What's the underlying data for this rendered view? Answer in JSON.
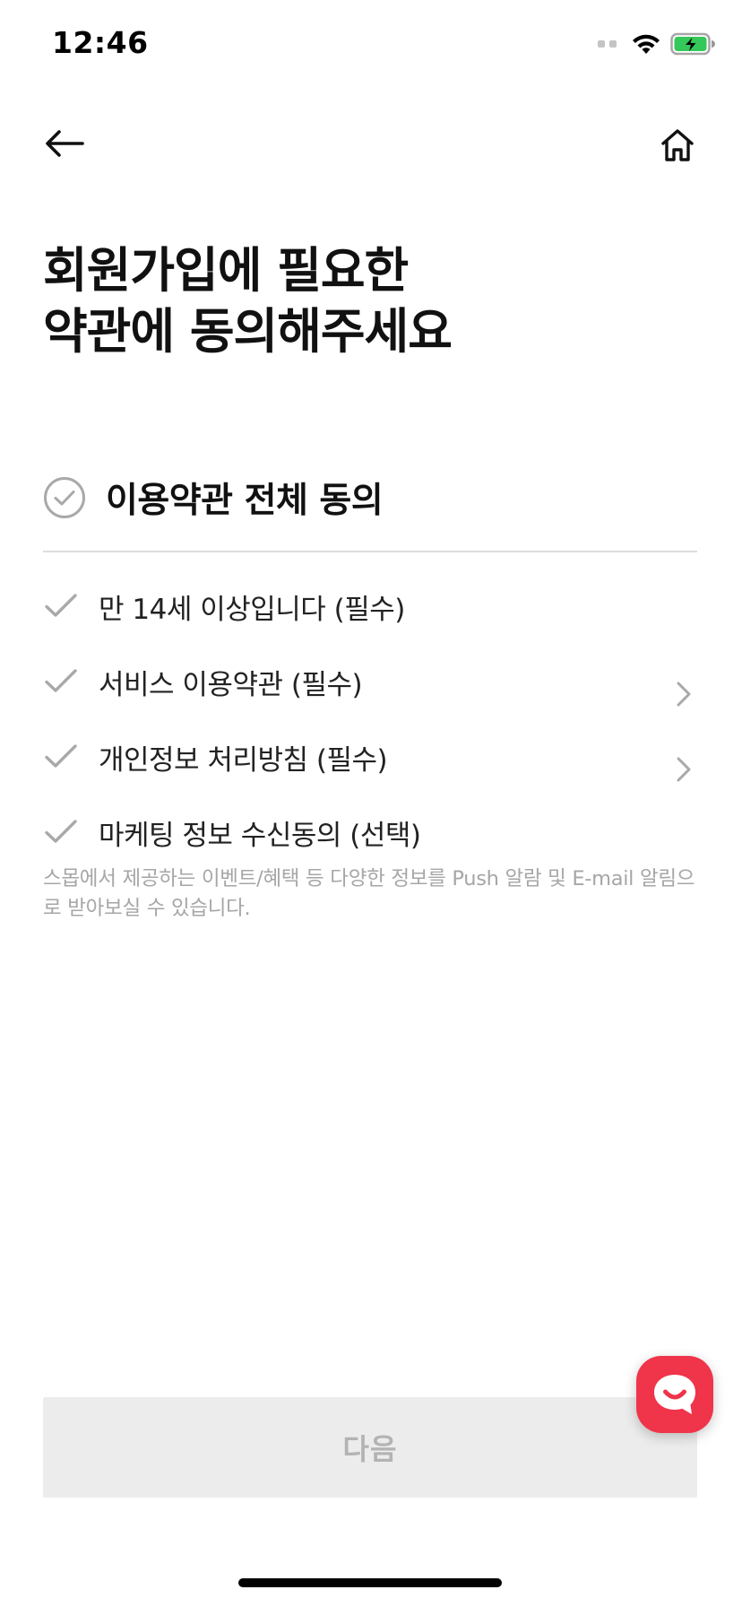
{
  "status_bar": {
    "time": "12:46",
    "icons": [
      "signal-icon",
      "wifi-icon",
      "battery-charging-icon"
    ],
    "battery_color": "#34c759"
  },
  "nav": {
    "back_icon": "arrow-left-icon",
    "home_icon": "home-icon"
  },
  "title": {
    "line1": "회원가입에 필요한",
    "line2": "약관에 동의해주세요"
  },
  "agree_all": {
    "label": "이용약관 전체 동의",
    "checked": false
  },
  "terms": [
    {
      "label": "만 14세 이상입니다 (필수)",
      "has_detail": false,
      "checked": false
    },
    {
      "label": "서비스 이용약관 (필수)",
      "has_detail": true,
      "checked": false
    },
    {
      "label": "개인정보 처리방침 (필수)",
      "has_detail": true,
      "checked": false
    },
    {
      "label": "마케팅 정보 수신동의 (선택)",
      "has_detail": false,
      "checked": false
    }
  ],
  "marketing_description": "스몹에서 제공하는 이벤트/혜택 등 다양한 정보를 Push 알람 및 E-mail 알림으로 받아보실 수 있습니다.",
  "next_button": {
    "label": "다음",
    "enabled": false
  },
  "chat": {
    "icon": "chat-bubble-icon",
    "color": "#f0344a"
  },
  "colors": {
    "check_gray": "#a9a9a9",
    "description_gray": "#a6a6a6",
    "disabled_bg": "#ececec",
    "disabled_text": "#b3b3b3"
  }
}
